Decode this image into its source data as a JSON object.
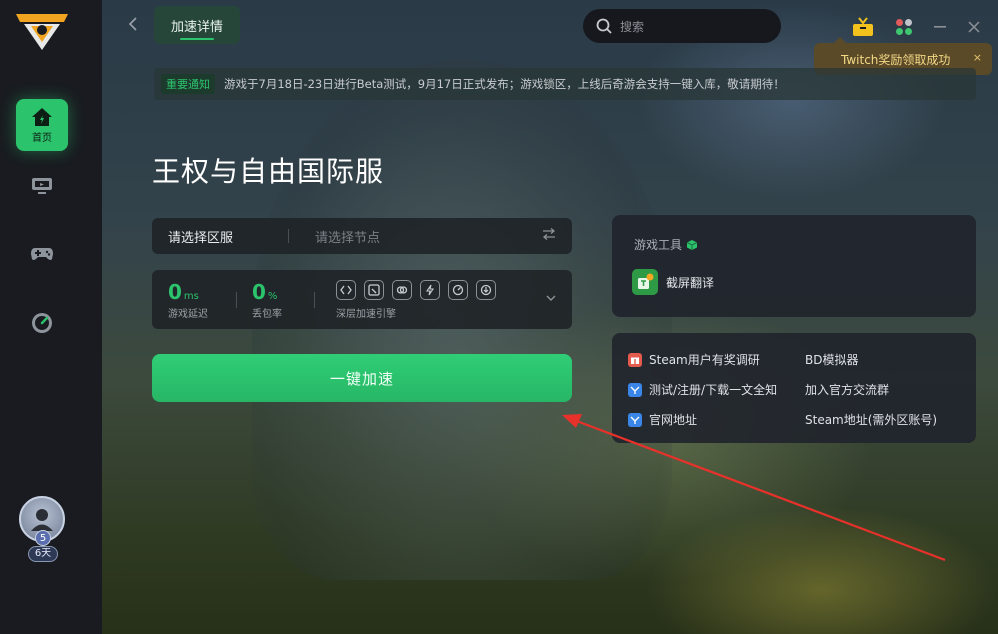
{
  "sidebar": {
    "items": [
      {
        "icon": "home-icon",
        "label": "首页",
        "active": true
      },
      {
        "icon": "monitor-icon"
      },
      {
        "icon": "gamepad-icon"
      },
      {
        "icon": "speedometer-icon"
      }
    ],
    "user": {
      "level": "5",
      "days": "6天"
    }
  },
  "header": {
    "active_tab": "加速详情",
    "search_placeholder": "搜索"
  },
  "toast": {
    "text": "Twitch奖励领取成功",
    "close": "×"
  },
  "notice": {
    "badge": "重要通知",
    "text": "游戏于7月18日-23日进行Beta测试，9月17日正式发布；游戏锁区，上线后奇游会支持一键入库，敬请期待！"
  },
  "game": {
    "title": "王权与自由国际服"
  },
  "region": {
    "label": "请选择区服",
    "node_placeholder": "请选择节点"
  },
  "stats": {
    "latency": {
      "value": "0",
      "unit": "ms",
      "caption": "游戏延迟"
    },
    "loss": {
      "value": "0",
      "unit": "%",
      "caption": "丢包率"
    },
    "engine_caption": "深层加速引擎"
  },
  "accelerate_button": "一键加速",
  "tools_panel": {
    "title": "游戏工具",
    "items": [
      {
        "label": "截屏翻译"
      }
    ]
  },
  "links": [
    {
      "label": "Steam用户有奖调研",
      "icon": "gift-icon",
      "color": "#e45a4c"
    },
    {
      "label": "BD模拟器"
    },
    {
      "label": "测试/注册/下载一文全知",
      "icon": "doc-icon",
      "color": "#3a86e8"
    },
    {
      "label": "加入官方交流群"
    },
    {
      "label": "官网地址",
      "icon": "doc-icon",
      "color": "#3a86e8"
    },
    {
      "label": "Steam地址(需外区账号)"
    }
  ],
  "colors": {
    "accent": "#2bc36c",
    "toast_text": "#f4d987",
    "annotation_arrow": "#e8312a"
  }
}
